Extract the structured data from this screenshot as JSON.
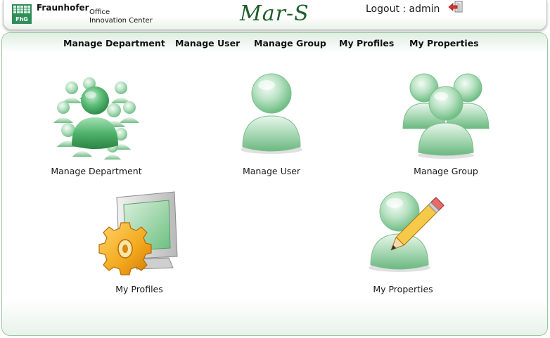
{
  "header": {
    "brand_name": "Fraunhofer",
    "brand_sub1": "Office",
    "brand_sub2": "Innovation Center",
    "logo_text": "FhG",
    "app_title": "Mar-S",
    "logout_label": "Logout : admin",
    "logout_icon": "logout-arrow-icon"
  },
  "nav": {
    "items": [
      {
        "label": "Manage Department"
      },
      {
        "label": "Manage User"
      },
      {
        "label": "Manage Group"
      },
      {
        "label": "My Profiles"
      },
      {
        "label": "My Properties"
      }
    ]
  },
  "tiles": [
    {
      "label": "Manage Department",
      "icon": "department-people-icon"
    },
    {
      "label": "Manage User",
      "icon": "user-icon"
    },
    {
      "label": "Manage Group",
      "icon": "group-icon"
    },
    {
      "label": "My Profiles",
      "icon": "monitor-gear-icon"
    },
    {
      "label": "My Properties",
      "icon": "user-pencil-icon"
    }
  ],
  "colors": {
    "brand_green": "#1e5e28",
    "icon_green": "#8fcfa0",
    "gear_orange": "#f2a81c",
    "panel_border": "#9cc5a2"
  }
}
